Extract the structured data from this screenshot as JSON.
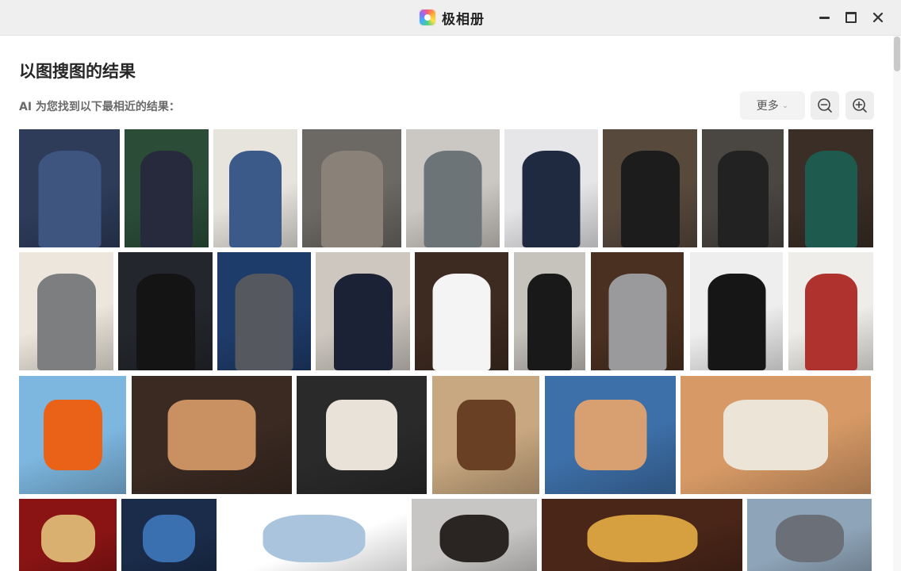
{
  "app": {
    "title": "极相册",
    "minimize_icon": "minimize-icon",
    "maximize_icon": "maximize-icon",
    "close_icon": "close-icon"
  },
  "page": {
    "title": "以图搜图的结果",
    "subtitle": "AI 为您找到以下最相近的结果："
  },
  "toolbar": {
    "more_label": "更多",
    "more_icon": "chevron-down-icon",
    "zoom_out_icon": "zoom-out-icon",
    "zoom_in_icon": "zoom-in-icon"
  },
  "results": [
    {
      "row": 1,
      "items": [
        {
          "subject": "navy double-breasted suit",
          "bg": "#2e3c5a",
          "fg": "#3e5580"
        },
        {
          "subject": "navy suit on mannequin",
          "bg": "#2b4d38",
          "fg": "#262a3c"
        },
        {
          "subject": "blue tweed suit on mannequin",
          "bg": "#e7e4de",
          "fg": "#3b5a8a"
        },
        {
          "subject": "grey check suit",
          "bg": "#6c6864",
          "fg": "#8a8278"
        },
        {
          "subject": "grey blazer with black turtleneck",
          "bg": "#cbc7c2",
          "fg": "#6d7478"
        },
        {
          "subject": "navy three-piece suit",
          "bg": "#e6e6e8",
          "fg": "#1f2a40"
        },
        {
          "subject": "black blazer with white shirt",
          "bg": "#58493d",
          "fg": "#1c1c1c"
        },
        {
          "subject": "black double-breasted suit on mannequin",
          "bg": "#4a4642",
          "fg": "#222222"
        },
        {
          "subject": "green suit on mannequin",
          "bg": "#3a2e26",
          "fg": "#1f5a4e"
        }
      ]
    },
    {
      "row": 2,
      "items": [
        {
          "subject": "grey blazer with black turtleneck",
          "bg": "#ece6dc",
          "fg": "#7c7e80"
        },
        {
          "subject": "black three-piece suit",
          "bg": "#23262c",
          "fg": "#141414"
        },
        {
          "subject": "grey double-breasted suit",
          "bg": "#1e3c6a",
          "fg": "#55585e"
        },
        {
          "subject": "navy suit mirror selfie",
          "bg": "#cdc7c0",
          "fg": "#1c2235"
        },
        {
          "subject": "white blazer",
          "bg": "#3d2a20",
          "fg": "#f4f4f4"
        },
        {
          "subject": "black suit seated",
          "bg": "#c6c2bc",
          "fg": "#191919"
        },
        {
          "subject": "grey blazer with black turtleneck",
          "bg": "#4a3020",
          "fg": "#9a9a9c"
        },
        {
          "subject": "black blazer with white t-shirt",
          "bg": "#eeeeee",
          "fg": "#161616"
        },
        {
          "subject": "red qipao dress on mannequin",
          "bg": "#efede9",
          "fg": "#b0322e"
        }
      ]
    },
    {
      "row": 3,
      "items": [
        {
          "subject": "orange handbag on blue chair",
          "bg": "#7db7e0",
          "fg": "#ea6218"
        },
        {
          "subject": "skeleton wristwatch on coffee beans",
          "bg": "#3a2a22",
          "fg": "#c99062"
        },
        {
          "subject": "rose gold wristwatch on black",
          "bg": "#2a2a2a",
          "fg": "#e9e2d8"
        },
        {
          "subject": "brown monogram bag",
          "bg": "#c8a880",
          "fg": "#6a4024"
        },
        {
          "subject": "wristwatch on leather box",
          "bg": "#3d6fa8",
          "fg": "#d8a070"
        },
        {
          "subject": "tonneau wristwatch",
          "bg": "#d79a66",
          "fg": "#ece4d6"
        }
      ]
    },
    {
      "row": 4,
      "items": [
        {
          "subject": "gold necklace and earrings on red",
          "bg": "#8a1414",
          "fg": "#d9b070"
        },
        {
          "subject": "blue dial wristwatch",
          "bg": "#1a2c4a",
          "fg": "#3a6fb0"
        },
        {
          "subject": "light blue sneaker",
          "bg": "#ffffff",
          "fg": "#a9c4dc"
        },
        {
          "subject": "black handbag",
          "bg": "#c8c6c4",
          "fg": "#2a2422"
        },
        {
          "subject": "gold sun earring",
          "bg": "#4a2618",
          "fg": "#d6a040"
        },
        {
          "subject": "grey sofa with yellow cushions",
          "bg": "#8ea4b8",
          "fg": "#6b7078"
        }
      ]
    }
  ]
}
